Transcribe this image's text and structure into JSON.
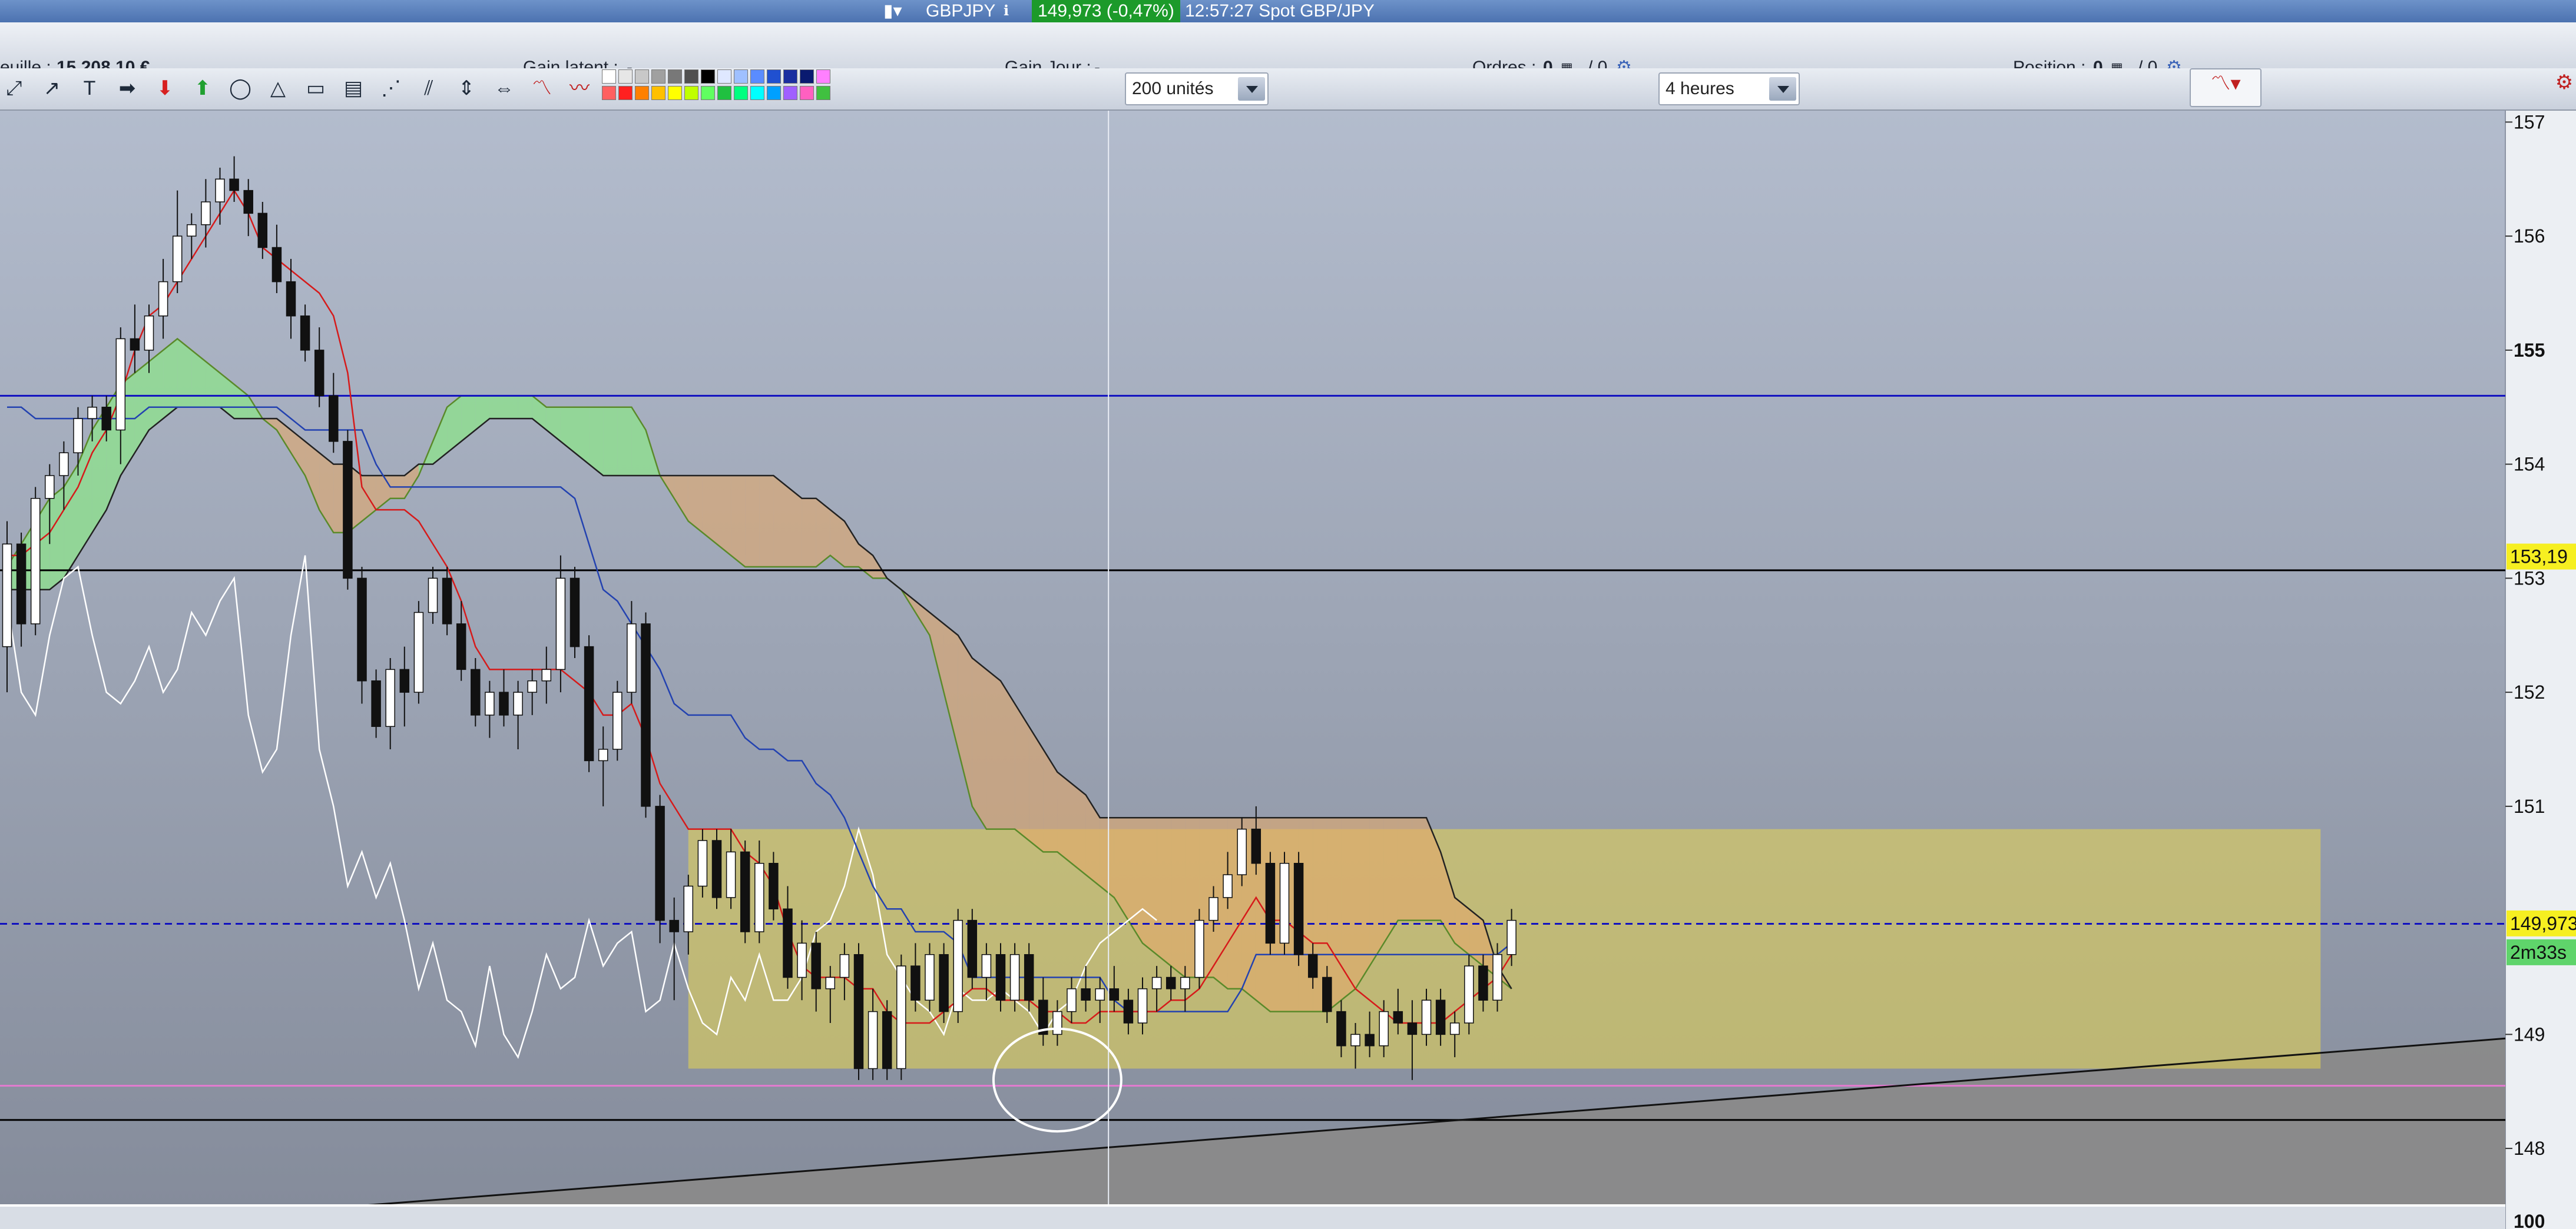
{
  "topbar": {
    "symbol": "GBPJPY",
    "price_box": "149,973 (-0,47%)",
    "time_desc": "12:57:27 Spot GBP/JPY"
  },
  "infobar": {
    "portfolio_label": "euille :",
    "portfolio_value": "15 208,10 €",
    "gain_latent_label": "Gain latent :",
    "gain_latent_value": "-",
    "gain_jour_label": "Gain Jour :",
    "gain_jour_value": "-",
    "ordres_label": "Ordres :",
    "ordres_value": "0",
    "ordres_count": "/ 0",
    "position_label": "Position :",
    "position_value": "0",
    "position_count": "/ 0"
  },
  "toolbar": {
    "units_select": "200 unités",
    "period_select": "4 heures"
  },
  "chart_data": {
    "type": "candlestick",
    "symbol": "GBPJPY",
    "timeframe": "4 heures",
    "ylim": [
      147.5,
      157.1
    ],
    "y_ticks": [
      157,
      156,
      155,
      154,
      153,
      152,
      151,
      149,
      148
    ],
    "y_tick_labels": [
      "157",
      "156",
      "155",
      "154",
      "153",
      "152",
      "151",
      "149",
      "148"
    ],
    "price_flags": [
      {
        "label": "153,19",
        "value": 153.19,
        "color": "#f6ef21"
      },
      {
        "label": "149,973",
        "value": 149.973,
        "color": "#f6ef21"
      },
      {
        "label": "2m33s",
        "value": 149.72,
        "color": "#5fd46b"
      }
    ],
    "indicator_axis_label": "100",
    "horizontal_lines": [
      {
        "value": 154.6,
        "color": "#1010c0",
        "style": "solid"
      },
      {
        "value": 153.07,
        "color": "#000000",
        "style": "solid"
      },
      {
        "value": 149.97,
        "color": "#1010c0",
        "style": "dashed"
      },
      {
        "value": 148.55,
        "color": "#e37ad0",
        "style": "solid"
      },
      {
        "value": 148.25,
        "color": "#000000",
        "style": "solid"
      }
    ],
    "candles": [
      [
        152.4,
        153.5,
        152.0,
        153.3
      ],
      [
        153.3,
        153.4,
        152.4,
        152.6
      ],
      [
        152.6,
        153.8,
        152.5,
        153.7
      ],
      [
        153.7,
        154.0,
        153.3,
        153.9
      ],
      [
        153.9,
        154.2,
        153.6,
        154.1
      ],
      [
        154.1,
        154.5,
        153.9,
        154.4
      ],
      [
        154.4,
        154.6,
        154.2,
        154.5
      ],
      [
        154.5,
        154.6,
        154.2,
        154.3
      ],
      [
        154.3,
        155.2,
        154.0,
        155.1
      ],
      [
        155.1,
        155.4,
        154.8,
        155.0
      ],
      [
        155.0,
        155.4,
        154.8,
        155.3
      ],
      [
        155.3,
        155.8,
        155.1,
        155.6
      ],
      [
        155.6,
        156.4,
        155.5,
        156.0
      ],
      [
        156.0,
        156.2,
        155.8,
        156.1
      ],
      [
        156.1,
        156.5,
        155.9,
        156.3
      ],
      [
        156.3,
        156.6,
        156.1,
        156.5
      ],
      [
        156.5,
        156.7,
        156.3,
        156.4
      ],
      [
        156.4,
        156.5,
        156.0,
        156.2
      ],
      [
        156.2,
        156.3,
        155.8,
        155.9
      ],
      [
        155.9,
        156.1,
        155.5,
        155.6
      ],
      [
        155.6,
        155.8,
        155.1,
        155.3
      ],
      [
        155.3,
        155.4,
        154.9,
        155.0
      ],
      [
        155.0,
        155.2,
        154.5,
        154.6
      ],
      [
        154.6,
        154.8,
        154.1,
        154.2
      ],
      [
        154.2,
        154.3,
        152.9,
        153.0
      ],
      [
        153.0,
        153.1,
        151.9,
        152.1
      ],
      [
        152.1,
        152.2,
        151.6,
        151.7
      ],
      [
        151.7,
        152.3,
        151.5,
        152.2
      ],
      [
        152.2,
        152.4,
        151.7,
        152.0
      ],
      [
        152.0,
        152.8,
        151.9,
        152.7
      ],
      [
        152.7,
        153.1,
        152.6,
        153.0
      ],
      [
        153.0,
        153.1,
        152.5,
        152.6
      ],
      [
        152.6,
        152.8,
        152.1,
        152.2
      ],
      [
        152.2,
        152.3,
        151.7,
        151.8
      ],
      [
        151.8,
        152.1,
        151.6,
        152.0
      ],
      [
        152.0,
        152.2,
        151.7,
        151.8
      ],
      [
        151.8,
        152.1,
        151.5,
        152.0
      ],
      [
        152.0,
        152.2,
        151.8,
        152.1
      ],
      [
        152.1,
        152.4,
        151.9,
        152.2
      ],
      [
        152.2,
        153.2,
        152.0,
        153.0
      ],
      [
        153.0,
        153.1,
        152.3,
        152.4
      ],
      [
        152.4,
        152.5,
        151.3,
        151.4
      ],
      [
        151.4,
        151.7,
        151.0,
        151.5
      ],
      [
        151.5,
        152.1,
        151.4,
        152.0
      ],
      [
        152.0,
        152.8,
        151.9,
        152.6
      ],
      [
        152.6,
        152.7,
        150.9,
        151.0
      ],
      [
        151.0,
        151.1,
        149.8,
        150.0
      ],
      [
        150.0,
        150.2,
        149.3,
        149.9
      ],
      [
        149.9,
        150.4,
        149.7,
        150.3
      ],
      [
        150.3,
        150.8,
        150.2,
        150.7
      ],
      [
        150.7,
        150.8,
        150.1,
        150.2
      ],
      [
        150.2,
        150.8,
        150.1,
        150.6
      ],
      [
        150.6,
        150.7,
        149.8,
        149.9
      ],
      [
        149.9,
        150.7,
        149.8,
        150.5
      ],
      [
        150.5,
        150.6,
        150.0,
        150.1
      ],
      [
        150.1,
        150.3,
        149.4,
        149.5
      ],
      [
        149.5,
        150.0,
        149.3,
        149.8
      ],
      [
        149.8,
        149.9,
        149.2,
        149.4
      ],
      [
        149.4,
        149.6,
        149.1,
        149.5
      ],
      [
        149.5,
        149.8,
        149.3,
        149.7
      ],
      [
        149.7,
        149.8,
        148.6,
        148.7
      ],
      [
        148.7,
        149.4,
        148.6,
        149.2
      ],
      [
        149.2,
        149.3,
        148.6,
        148.7
      ],
      [
        148.7,
        149.7,
        148.6,
        149.6
      ],
      [
        149.6,
        149.8,
        149.2,
        149.3
      ],
      [
        149.3,
        149.8,
        149.2,
        149.7
      ],
      [
        149.7,
        149.8,
        149.1,
        149.2
      ],
      [
        149.2,
        150.1,
        149.1,
        150.0
      ],
      [
        150.0,
        150.1,
        149.4,
        149.5
      ],
      [
        149.5,
        149.8,
        149.3,
        149.7
      ],
      [
        149.7,
        149.8,
        149.2,
        149.3
      ],
      [
        149.3,
        149.8,
        149.2,
        149.7
      ],
      [
        149.7,
        149.8,
        149.2,
        149.3
      ],
      [
        149.3,
        149.5,
        148.9,
        149.0
      ],
      [
        149.0,
        149.3,
        148.9,
        149.2
      ],
      [
        149.2,
        149.5,
        149.1,
        149.4
      ],
      [
        149.4,
        149.6,
        149.2,
        149.3
      ],
      [
        149.3,
        149.5,
        149.1,
        149.4
      ],
      [
        149.4,
        149.6,
        149.2,
        149.3
      ],
      [
        149.3,
        149.4,
        149.0,
        149.1
      ],
      [
        149.1,
        149.5,
        149.0,
        149.4
      ],
      [
        149.4,
        149.6,
        149.2,
        149.5
      ],
      [
        149.5,
        149.6,
        149.3,
        149.4
      ],
      [
        149.4,
        149.6,
        149.2,
        149.5
      ],
      [
        149.5,
        150.1,
        149.4,
        150.0
      ],
      [
        150.0,
        150.3,
        149.9,
        150.2
      ],
      [
        150.2,
        150.6,
        150.1,
        150.4
      ],
      [
        150.4,
        150.9,
        150.3,
        150.8
      ],
      [
        150.8,
        151.0,
        150.4,
        150.5
      ],
      [
        150.5,
        150.6,
        149.7,
        149.8
      ],
      [
        149.8,
        150.6,
        149.7,
        150.5
      ],
      [
        150.5,
        150.6,
        149.6,
        149.7
      ],
      [
        149.7,
        149.8,
        149.4,
        149.5
      ],
      [
        149.5,
        149.6,
        149.1,
        149.2
      ],
      [
        149.2,
        149.3,
        148.8,
        148.9
      ],
      [
        148.9,
        149.1,
        148.7,
        149.0
      ],
      [
        149.0,
        149.2,
        148.8,
        148.9
      ],
      [
        148.9,
        149.3,
        148.8,
        149.2
      ],
      [
        149.2,
        149.4,
        149.0,
        149.1
      ],
      [
        149.1,
        149.3,
        148.6,
        149.0
      ],
      [
        149.0,
        149.4,
        148.9,
        149.3
      ],
      [
        149.3,
        149.4,
        148.9,
        149.0
      ],
      [
        149.0,
        149.2,
        148.8,
        149.1
      ],
      [
        149.1,
        149.7,
        149.0,
        149.6
      ],
      [
        149.6,
        149.7,
        149.2,
        149.3
      ],
      [
        149.3,
        149.8,
        149.2,
        149.7
      ],
      [
        149.7,
        150.1,
        149.6,
        150.0
      ]
    ],
    "ichimoku": {
      "tenkan": [
        153.2,
        153.2,
        153.3,
        153.4,
        153.6,
        153.8,
        154.1,
        154.3,
        154.6,
        155.0,
        155.3,
        155.4,
        155.6,
        155.8,
        156.0,
        156.2,
        156.4,
        156.2,
        155.9,
        155.8,
        155.7,
        155.6,
        155.5,
        155.3,
        154.8,
        153.8,
        153.6,
        153.6,
        153.6,
        153.5,
        153.3,
        153.1,
        152.8,
        152.4,
        152.2,
        152.2,
        152.2,
        152.2,
        152.2,
        152.2,
        152.1,
        152.0,
        151.8,
        151.8,
        151.9,
        151.6,
        151.2,
        151.0,
        150.8,
        150.8,
        150.8,
        150.8,
        150.6,
        150.5,
        150.3,
        149.9,
        149.6,
        149.5,
        149.5,
        149.5,
        149.4,
        149.4,
        149.2,
        149.1,
        149.1,
        149.1,
        149.2,
        149.3,
        149.4,
        149.4,
        149.3,
        149.3,
        149.3,
        149.2,
        149.2,
        149.1,
        149.1,
        149.2,
        149.2,
        149.2,
        149.2,
        149.2,
        149.3,
        149.3,
        149.4,
        149.6,
        149.8,
        150.0,
        150.2,
        150.0,
        150.0,
        149.9,
        149.8,
        149.8,
        149.6,
        149.4,
        149.3,
        149.2,
        149.1,
        149.1,
        149.1,
        149.1,
        149.2,
        149.3,
        149.4,
        149.5,
        149.7
      ],
      "kijun": [
        154.5,
        154.5,
        154.4,
        154.4,
        154.4,
        154.4,
        154.4,
        154.4,
        154.4,
        154.4,
        154.5,
        154.5,
        154.5,
        154.5,
        154.5,
        154.5,
        154.5,
        154.5,
        154.5,
        154.5,
        154.4,
        154.3,
        154.3,
        154.3,
        154.3,
        154.3,
        154.0,
        153.8,
        153.8,
        153.8,
        153.8,
        153.8,
        153.8,
        153.8,
        153.8,
        153.8,
        153.8,
        153.8,
        153.8,
        153.8,
        153.7,
        153.3,
        152.9,
        152.8,
        152.6,
        152.4,
        152.2,
        151.9,
        151.8,
        151.8,
        151.8,
        151.8,
        151.6,
        151.5,
        151.5,
        151.4,
        151.4,
        151.2,
        151.1,
        150.9,
        150.6,
        150.3,
        150.1,
        150.1,
        149.9,
        149.9,
        149.9,
        149.8,
        149.5,
        149.5,
        149.5,
        149.5,
        149.5,
        149.5,
        149.5,
        149.5,
        149.5,
        149.5,
        149.3,
        149.2,
        149.2,
        149.2,
        149.2,
        149.2,
        149.2,
        149.2,
        149.2,
        149.4,
        149.7,
        149.7,
        149.7,
        149.7,
        149.7,
        149.7,
        149.7,
        149.7,
        149.7,
        149.7,
        149.7,
        149.7,
        149.7,
        149.7,
        149.7,
        149.7,
        149.7,
        149.7,
        149.8
      ],
      "senkou_a": [
        153.1,
        153.3,
        153.5,
        153.7,
        153.8,
        154.0,
        154.3,
        154.5,
        154.7,
        154.8,
        154.9,
        155.0,
        155.1,
        155.0,
        154.9,
        154.8,
        154.7,
        154.6,
        154.4,
        154.3,
        154.1,
        153.9,
        153.6,
        153.4,
        153.4,
        153.5,
        153.6,
        153.7,
        153.7,
        153.9,
        154.2,
        154.5,
        154.6,
        154.6,
        154.6,
        154.6,
        154.6,
        154.6,
        154.5,
        154.5,
        154.5,
        154.5,
        154.5,
        154.5,
        154.5,
        154.3,
        153.9,
        153.7,
        153.5,
        153.4,
        153.3,
        153.2,
        153.1,
        153.1,
        153.1,
        153.1,
        153.1,
        153.1,
        153.2,
        153.1,
        153.1,
        153.0,
        153.0,
        152.9,
        152.7,
        152.5,
        152.0,
        151.5,
        151.0,
        150.8,
        150.8,
        150.8,
        150.7,
        150.6,
        150.6,
        150.5,
        150.4,
        150.3,
        150.2,
        150.0,
        149.8,
        149.7,
        149.6,
        149.5,
        149.5,
        149.5,
        149.4,
        149.4,
        149.3,
        149.2,
        149.2,
        149.2,
        149.2,
        149.2,
        149.3,
        149.4,
        149.6,
        149.8,
        150.0,
        150.0,
        150.0,
        150.0,
        149.8,
        149.7,
        149.6,
        149.5,
        149.4
      ],
      "senkou_b": [
        152.9,
        152.9,
        152.9,
        152.9,
        153.0,
        153.2,
        153.4,
        153.6,
        153.9,
        154.1,
        154.3,
        154.4,
        154.5,
        154.5,
        154.5,
        154.5,
        154.4,
        154.4,
        154.4,
        154.4,
        154.3,
        154.2,
        154.1,
        154.0,
        154.0,
        153.9,
        153.9,
        153.9,
        153.9,
        154.0,
        154.0,
        154.1,
        154.2,
        154.3,
        154.4,
        154.4,
        154.4,
        154.4,
        154.3,
        154.2,
        154.1,
        154.0,
        153.9,
        153.9,
        153.9,
        153.9,
        153.9,
        153.9,
        153.9,
        153.9,
        153.9,
        153.9,
        153.9,
        153.9,
        153.9,
        153.8,
        153.7,
        153.7,
        153.6,
        153.5,
        153.3,
        153.2,
        153.0,
        152.9,
        152.8,
        152.7,
        152.6,
        152.5,
        152.3,
        152.2,
        152.1,
        151.9,
        151.7,
        151.5,
        151.3,
        151.2,
        151.1,
        150.9,
        150.9,
        150.9,
        150.9,
        150.9,
        150.9,
        150.9,
        150.9,
        150.9,
        150.9,
        150.9,
        150.9,
        150.9,
        150.9,
        150.9,
        150.9,
        150.9,
        150.9,
        150.9,
        150.9,
        150.9,
        150.9,
        150.9,
        150.9,
        150.6,
        150.2,
        150.1,
        150.0,
        149.6,
        149.4
      ],
      "chikou": [
        152.8,
        152.0,
        151.8,
        152.5,
        153.0,
        153.1,
        152.5,
        152.0,
        151.9,
        152.1,
        152.4,
        152.0,
        152.2,
        152.7,
        152.5,
        152.8,
        153.0,
        151.8,
        151.3,
        151.5,
        152.5,
        153.2,
        151.5,
        151.0,
        150.3,
        150.6,
        150.2,
        150.5,
        150.0,
        149.4,
        149.8,
        149.3,
        149.2,
        148.9,
        149.6,
        149.0,
        148.8,
        149.2,
        149.7,
        149.4,
        149.5,
        150.0,
        149.6,
        149.8,
        149.9,
        149.2,
        149.3,
        149.8,
        149.4,
        149.1,
        149.0,
        149.5,
        149.3,
        149.7,
        149.3,
        149.3,
        149.5,
        149.9,
        150.0,
        150.3,
        150.8,
        150.4,
        149.7,
        149.5,
        149.3,
        149.2,
        149.0,
        149.4,
        149.3,
        149.3,
        149.4,
        149.3,
        149.2,
        149.0,
        149.2,
        149.3,
        149.6,
        149.8,
        149.9,
        150.0,
        150.1,
        150.0
      ]
    },
    "zone_rect": {
      "x_start": 48,
      "x_end": 163,
      "y_low": 148.7,
      "y_high": 150.8
    },
    "trendline": {
      "x_start": 20,
      "y_start": 147.45,
      "x_end": 190,
      "y_end": 149.1
    },
    "highlight_circle": {
      "x_center": 74,
      "y_center": 148.6,
      "rx": 4.5,
      "ry": 0.45
    },
    "crosshair_x": 77.6
  }
}
